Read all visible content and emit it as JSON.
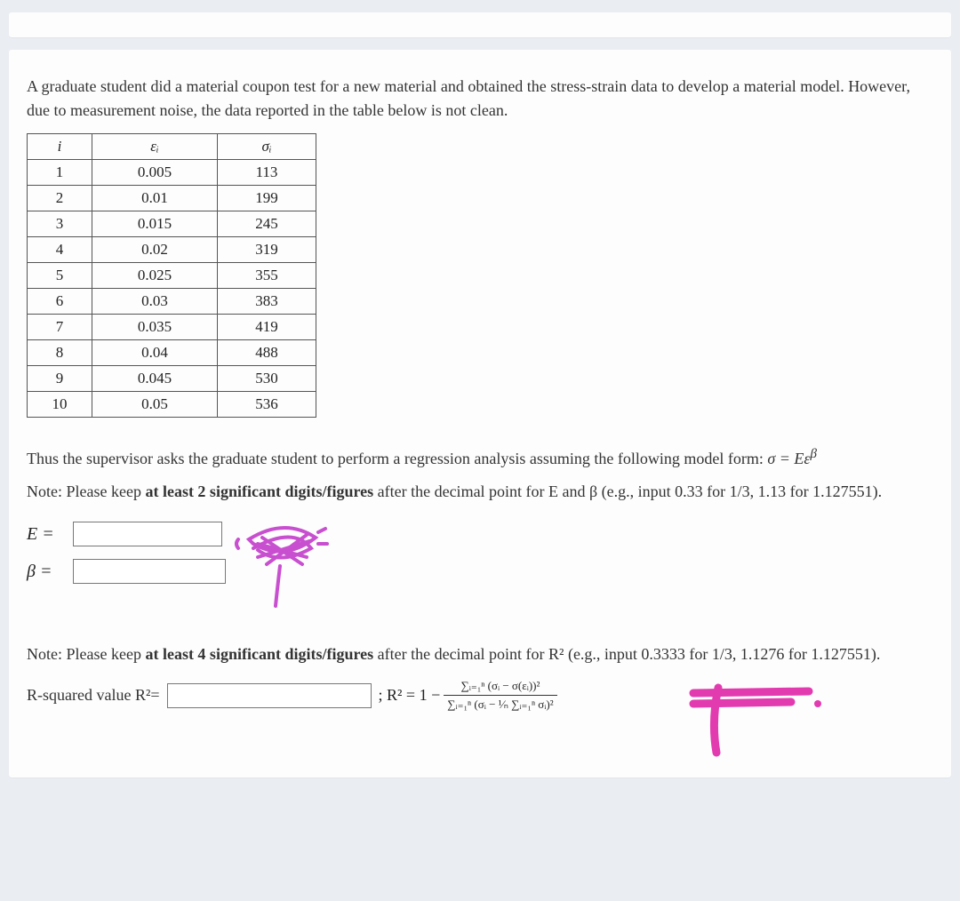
{
  "intro": "A graduate student did a material coupon test for a new material and obtained the stress-strain data to develop a material model. However, due to measurement noise, the data reported in the table below is not clean.",
  "table": {
    "headers": {
      "i": "i",
      "eps": "εᵢ",
      "sigma": "σᵢ"
    },
    "rows": [
      {
        "i": "1",
        "eps": "0.005",
        "sigma": "113"
      },
      {
        "i": "2",
        "eps": "0.01",
        "sigma": "199"
      },
      {
        "i": "3",
        "eps": "0.015",
        "sigma": "245"
      },
      {
        "i": "4",
        "eps": "0.02",
        "sigma": "319"
      },
      {
        "i": "5",
        "eps": "0.025",
        "sigma": "355"
      },
      {
        "i": "6",
        "eps": "0.03",
        "sigma": "383"
      },
      {
        "i": "7",
        "eps": "0.035",
        "sigma": "419"
      },
      {
        "i": "8",
        "eps": "0.04",
        "sigma": "488"
      },
      {
        "i": "9",
        "eps": "0.045",
        "sigma": "530"
      },
      {
        "i": "10",
        "eps": "0.05",
        "sigma": "536"
      }
    ]
  },
  "prompt_model_pre": "Thus the supervisor asks the graduate student to perform a regression analysis assuming the following model form: ",
  "model_form": "σ = Eε",
  "model_exp": "β",
  "note1_pre": "Note: Please keep ",
  "note1_bold": "at least 2 significant digits/figures",
  "note1_post": " after the decimal point for E and β (e.g., input 0.33 for 1/3,  1.13 for 1.127551).",
  "labels": {
    "E": "E =",
    "beta": "β =",
    "Rsq": "R-squared value R²="
  },
  "inputs": {
    "E": "",
    "beta": "",
    "Rsq": ""
  },
  "note2_pre": "Note: Please keep ",
  "note2_bold": "at least 4 significant digits/figures",
  "note2_post": " after the decimal point for R² (e.g., input 0.3333 for 1/3,  1.1276 for 1.127551).",
  "rsq_formula": {
    "lead": ";  R² = 1 − ",
    "num": "∑ᵢ₌₁ⁿ (σᵢ − σ(εᵢ))²",
    "den": "∑ᵢ₌₁ⁿ (σᵢ − ¹⁄ₙ ∑ᵢ₌₁ⁿ σᵢ)²"
  }
}
